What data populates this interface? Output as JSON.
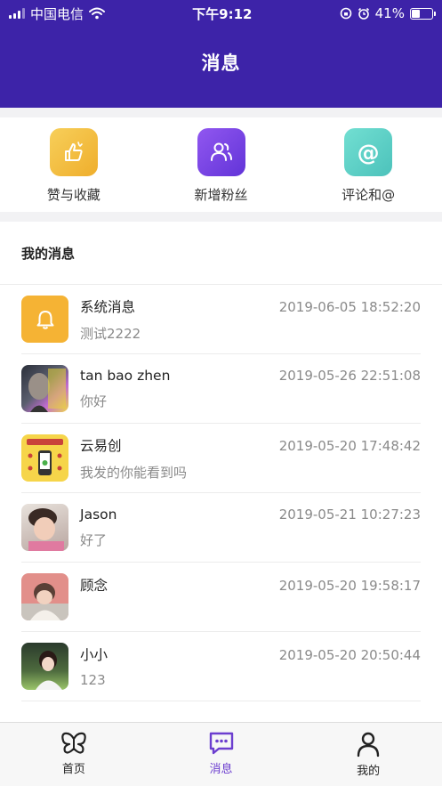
{
  "status_bar": {
    "carrier": "中国电信",
    "time": "下午9:12",
    "battery": "41%",
    "battery_level": 0.41
  },
  "header": {
    "title": "消息"
  },
  "quick_actions": [
    {
      "label": "赞与收藏",
      "icon": "thumbs-up-icon",
      "color": "#f2c042"
    },
    {
      "label": "新增粉丝",
      "icon": "users-icon",
      "color": "#7c4de8"
    },
    {
      "label": "评论和@",
      "icon": "at-icon",
      "color": "#5fd3c8"
    }
  ],
  "messages": {
    "section_title": "我的消息",
    "items": [
      {
        "name": "系统消息",
        "time": "2019-06-05 18:52:20",
        "preview": "测试2222",
        "avatar": "bell-icon"
      },
      {
        "name": "tan bao zhen",
        "time": "2019-05-26 22:51:08",
        "preview": "你好",
        "avatar": "user-photo"
      },
      {
        "name": "云易创",
        "time": "2019-05-20 17:48:42",
        "preview": "我发的你能看到吗",
        "avatar": "app-logo"
      },
      {
        "name": "Jason",
        "time": "2019-05-21 10:27:23",
        "preview": "好了",
        "avatar": "user-photo"
      },
      {
        "name": "顾念",
        "time": "2019-05-20 19:58:17",
        "preview": "",
        "avatar": "user-photo"
      },
      {
        "name": "小小",
        "time": "2019-05-20 20:50:44",
        "preview": "123",
        "avatar": "user-photo"
      }
    ]
  },
  "tabbar": [
    {
      "label": "首页",
      "icon": "butterfly-icon"
    },
    {
      "label": "消息",
      "icon": "chat-icon",
      "active": true
    },
    {
      "label": "我的",
      "icon": "person-icon"
    }
  ],
  "colors": {
    "header_bg": "#3d23a8",
    "accent": "#6c3ecf",
    "system_msg_icon": "#f5b334"
  }
}
